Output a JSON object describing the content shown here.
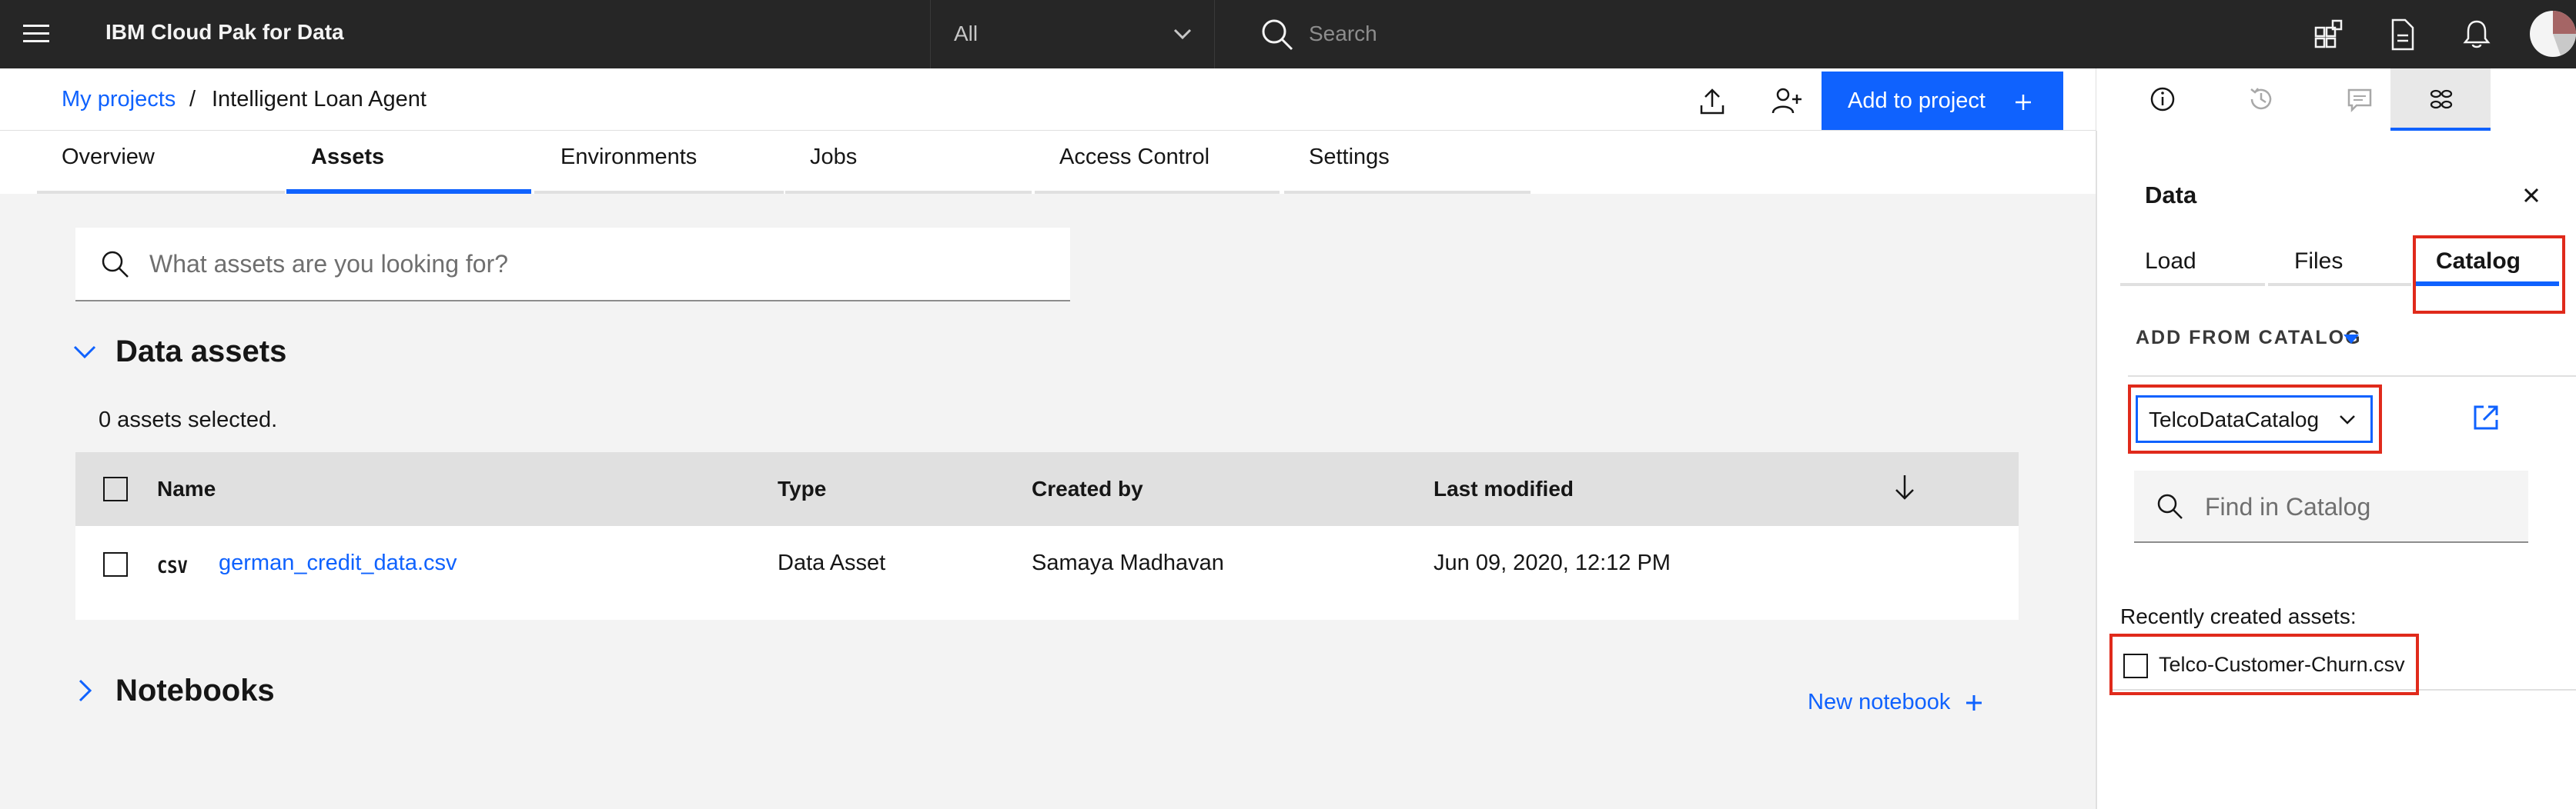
{
  "header": {
    "app_title": "IBM Cloud Pak for Data",
    "scope_selected": "All",
    "search_placeholder": "Search",
    "icons": [
      "hamburger-icon",
      "search-icon",
      "apps-icon",
      "document-icon",
      "notification-icon",
      "user-avatar"
    ]
  },
  "project": {
    "breadcrumb_root": "My projects",
    "breadcrumb_sep": "/",
    "name": "Intelligent Loan Agent",
    "add_button": "Add to project",
    "tabs": [
      {
        "label": "Overview",
        "active": false
      },
      {
        "label": "Assets",
        "active": true
      },
      {
        "label": "Environments",
        "active": false
      },
      {
        "label": "Jobs",
        "active": false
      },
      {
        "label": "Access Control",
        "active": false
      },
      {
        "label": "Settings",
        "active": false
      }
    ]
  },
  "assets": {
    "search_placeholder": "What assets are you looking for?",
    "data_assets_title": "Data assets",
    "selected_text": "0 assets selected.",
    "columns": [
      "Name",
      "Type",
      "Created by",
      "Last modified"
    ],
    "rows": [
      {
        "tag": "CSV",
        "name": "german_credit_data.csv",
        "type": "Data Asset",
        "created_by": "Samaya Madhavan",
        "modified": "Jun 09, 2020, 12:12 PM"
      }
    ],
    "notebooks_title": "Notebooks",
    "new_notebook": "New notebook"
  },
  "panel": {
    "title": "Data",
    "tabs": [
      {
        "label": "Load",
        "active": false
      },
      {
        "label": "Files",
        "active": false
      },
      {
        "label": "Catalog",
        "active": true
      }
    ],
    "add_from_catalog": "ADD FROM CATALOG",
    "catalog_selected": "TelcoDataCatalog",
    "find_placeholder": "Find in Catalog",
    "recent_label": "Recently created assets:",
    "recent_items": [
      "Telco-Customer-Churn.csv"
    ]
  },
  "colors": {
    "accent": "#0f62fe",
    "header_bg": "#262626",
    "highlight": "#e02a1b"
  }
}
